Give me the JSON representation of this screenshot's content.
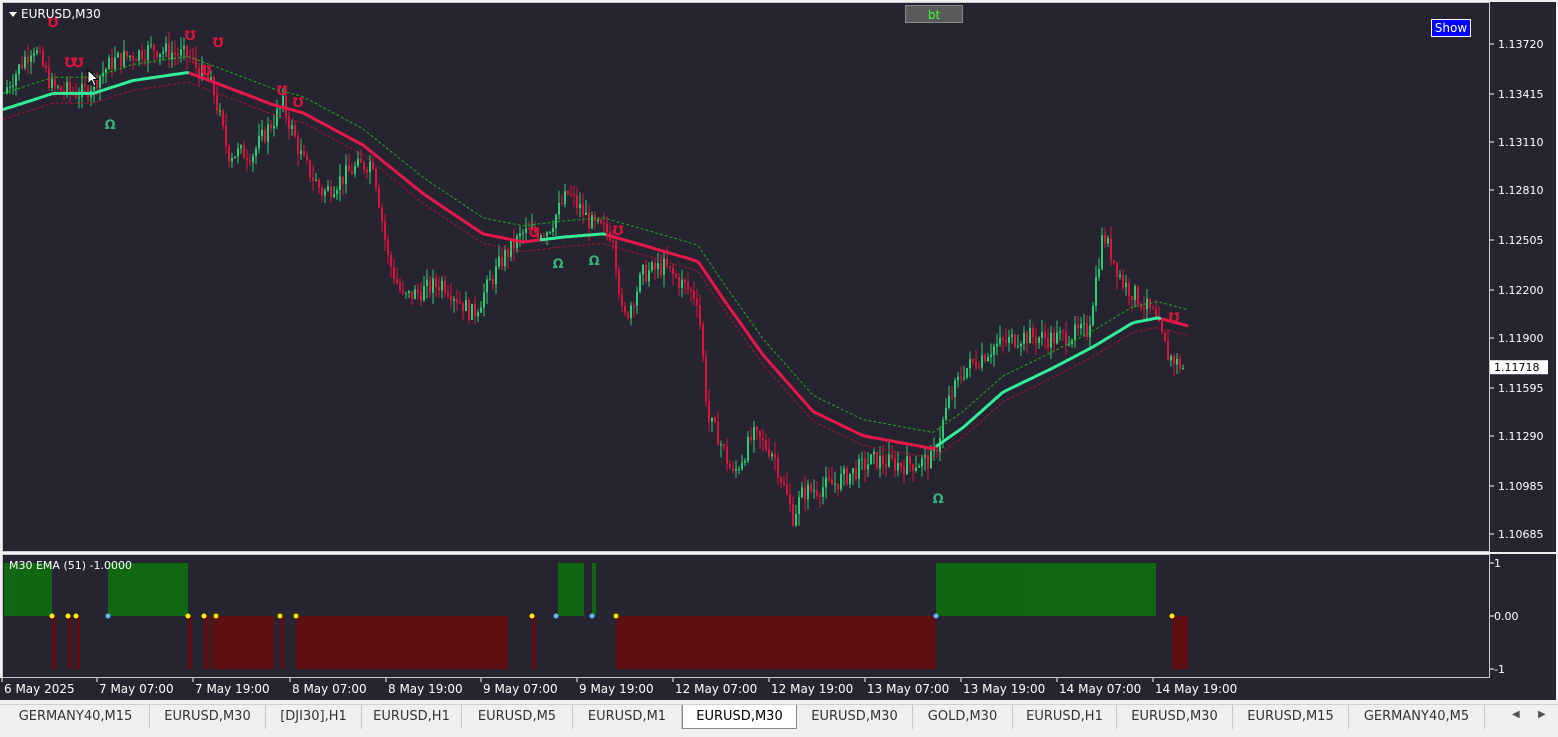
{
  "chart": {
    "symbol_title": "EURUSD,M30",
    "bt_label": "bt",
    "show_label": "Show",
    "current_price": "1.11718",
    "price_ticks": [
      "1.13720",
      "1.13415",
      "1.13110",
      "1.12810",
      "1.12505",
      "1.12200",
      "1.11900",
      "1.11595",
      "1.11290",
      "1.10985",
      "1.10685"
    ],
    "time_labels": [
      "6 May 2025",
      "7 May 07:00",
      "7 May 19:00",
      "8 May 07:00",
      "8 May 19:00",
      "9 May 07:00",
      "9 May 19:00",
      "12 May 07:00",
      "12 May 19:00",
      "13 May 07:00",
      "13 May 19:00",
      "14 May 07:00",
      "14 May 19:00"
    ],
    "colors": {
      "background": "#262430",
      "bull": "#2ecc71",
      "bear": "#dc143c",
      "ema_up": "#33ee99",
      "ema_down": "#e8174a",
      "histogram_up": "#0a7a0a",
      "histogram_down": "#6b0a0a",
      "dot_yellow": "#ffee00",
      "dot_blue": "#66b3ff"
    }
  },
  "indicator": {
    "title": "M30 EMA (51) -1.0000",
    "scale_ticks": [
      "1",
      "0.00",
      "-1"
    ]
  },
  "tabs": {
    "items": [
      {
        "label": "GERMANY40,M15"
      },
      {
        "label": "EURUSD,M30"
      },
      {
        "label": "[DJI30],H1"
      },
      {
        "label": "EURUSD,H1"
      },
      {
        "label": "EURUSD,M5"
      },
      {
        "label": "EURUSD,M1"
      },
      {
        "label": "EURUSD,M30"
      },
      {
        "label": "EURUSD,M30"
      },
      {
        "label": "GOLD,M30"
      },
      {
        "label": "EURUSD,H1"
      },
      {
        "label": "EURUSD,M30"
      },
      {
        "label": "EURUSD,M15"
      },
      {
        "label": "GERMANY40,M5"
      }
    ],
    "active_index": 6
  },
  "chart_data": {
    "type": "line",
    "title": "EURUSD,M30",
    "x": [
      "6 May 2025",
      "7 May 07:00",
      "7 May 19:00",
      "8 May 07:00",
      "8 May 19:00",
      "9 May 07:00",
      "9 May 19:00",
      "12 May 07:00",
      "12 May 19:00",
      "13 May 07:00",
      "13 May 19:00",
      "14 May 07:00",
      "14 May 19:00"
    ],
    "series": [
      {
        "values": [
          1.1342,
          1.1359,
          1.1357,
          1.1331,
          1.1312,
          1.1249,
          1.1258,
          1.1232,
          1.116,
          1.1122,
          1.116,
          1.119,
          1.119
        ]
      },
      {
        "values": [
          1.1365,
          1.1375,
          1.135,
          1.1315,
          1.122,
          1.1255,
          1.126,
          1.1225,
          1.1095,
          1.1105,
          1.1193,
          1.1215,
          1.1172
        ]
      }
    ],
    "ylim": [
      1.106,
      1.139
    ],
    "current_price": 1.11718,
    "indicator_values": [
      1,
      1,
      -1,
      -1,
      -1,
      -1,
      1,
      -1,
      -1,
      -1,
      1,
      1,
      -1
    ]
  }
}
